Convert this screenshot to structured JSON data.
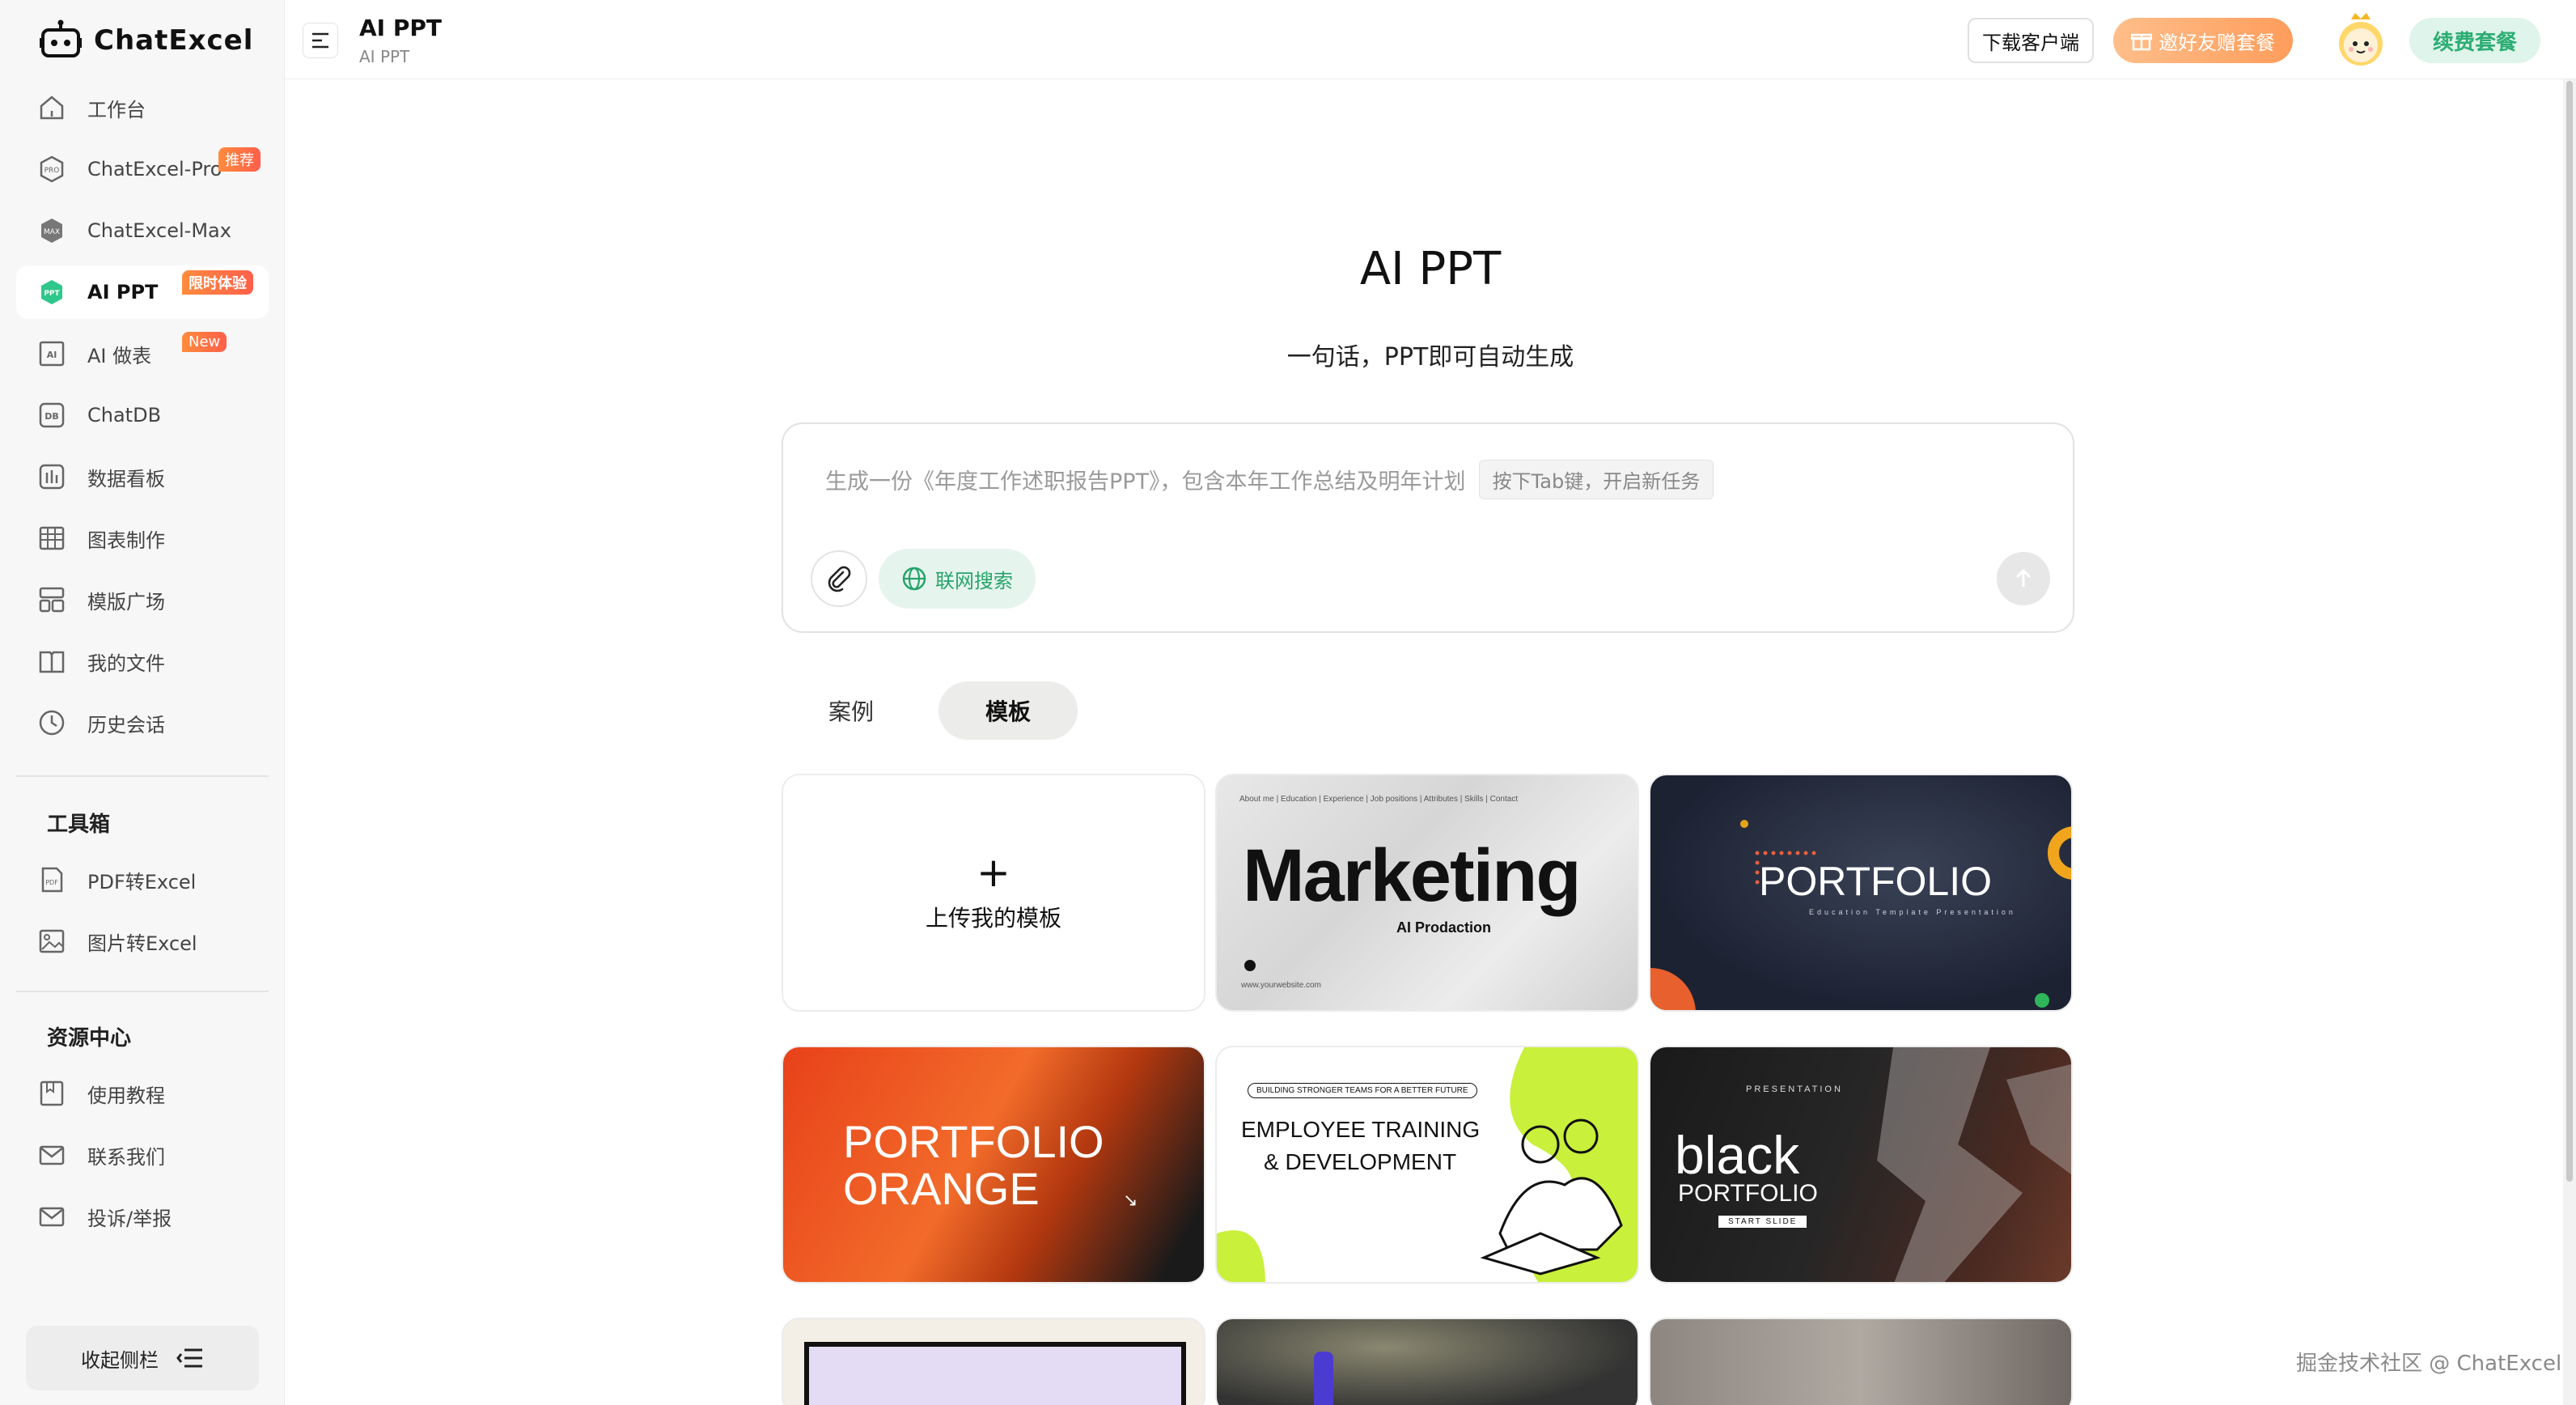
{
  "brand": {
    "name": "ChatExcel"
  },
  "sidebar": {
    "items": [
      {
        "label": "工作台",
        "icon": "home-icon"
      },
      {
        "label": "ChatExcel-Pro",
        "icon": "pro-icon",
        "badge": "推荐"
      },
      {
        "label": "ChatExcel-Max",
        "icon": "max-icon"
      },
      {
        "label": "AI PPT",
        "icon": "ppt-icon",
        "badge": "限时体验"
      },
      {
        "label": "AI 做表",
        "icon": "ai-table-icon",
        "badge": "New"
      },
      {
        "label": "ChatDB",
        "icon": "db-icon"
      },
      {
        "label": "数据看板",
        "icon": "dashboard-icon"
      },
      {
        "label": "图表制作",
        "icon": "chart-icon"
      },
      {
        "label": "模版广场",
        "icon": "template-icon"
      },
      {
        "label": "我的文件",
        "icon": "folder-icon"
      },
      {
        "label": "历史会话",
        "icon": "clock-icon"
      }
    ],
    "toolbox_title": "工具箱",
    "tools": [
      {
        "label": "PDF转Excel",
        "icon": "pdf-icon"
      },
      {
        "label": "图片转Excel",
        "icon": "image-icon"
      }
    ],
    "resources_title": "资源中心",
    "resources": [
      {
        "label": "使用教程",
        "icon": "book-icon"
      },
      {
        "label": "联系我们",
        "icon": "mail-icon"
      },
      {
        "label": "投诉/举报",
        "icon": "mail-icon"
      }
    ],
    "collapse_label": "收起侧栏"
  },
  "header": {
    "title": "AI PPT",
    "subtitle": "AI PPT",
    "download_label": "下载客户端",
    "invite_label": "邀好友赠套餐",
    "renew_label": "续费套餐"
  },
  "main": {
    "title": "AI PPT",
    "subtitle": "一句话，PPT即可自动生成",
    "prompt_placeholder": "生成一份《年度工作述职报告PPT》，包含本年工作总结及明年计划",
    "tab_hint": "按下Tab键，开启新任务",
    "web_search_label": "联网搜索",
    "tabs": [
      {
        "label": "案例",
        "active": false
      },
      {
        "label": "模板",
        "active": true
      }
    ],
    "upload_label": "上传我的模板",
    "templates": [
      {
        "title": "Marketing",
        "subtitle": "AI Prodaction",
        "topline": "About me  |  Education  |  Experience  |  Job positions  |  Attributes  |  Skills  |  Contact",
        "url": "www.yourwebsite.com"
      },
      {
        "title": "PORTFOLIO",
        "subtitle": "Education Template Presentation"
      },
      {
        "title": "PORTFOLIO ORANGE",
        "line1": "PORTFOLIO",
        "line2": "ORANGE"
      },
      {
        "title": "EMPLOYEE TRAINING & DEVELOPMENT",
        "line1": "EMPLOYEE TRAINING",
        "line2": "& DEVELOPMENT",
        "tag": "BUILDING STRONGER TEAMS FOR A BETTER FUTURE"
      },
      {
        "title": "black PORTFOLIO",
        "line1": "black",
        "line2": "PORTFOLIO",
        "tag": "PRESENTATION",
        "button": "START SLIDE"
      }
    ]
  },
  "watermark": "掘金技术社区 @ ChatExcel"
}
